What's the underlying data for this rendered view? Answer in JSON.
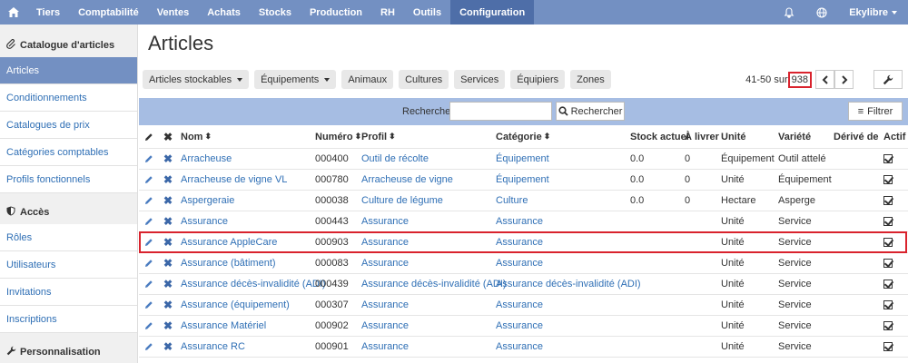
{
  "topnav": {
    "home_icon": "home-icon",
    "items": [
      "Tiers",
      "Comptabilité",
      "Ventes",
      "Achats",
      "Stocks",
      "Production",
      "RH",
      "Outils",
      "Configuration"
    ],
    "active": "Configuration",
    "user": "Ekylibre",
    "right_icons": [
      "bell-icon",
      "globe-icon"
    ]
  },
  "sidebar": {
    "sections": [
      {
        "title": "Catalogue d'articles",
        "icon": "paperclip-icon",
        "items": [
          "Articles",
          "Conditionnements",
          "Catalogues de prix",
          "Catégories comptables",
          "Profils fonctionnels"
        ]
      },
      {
        "title": "Accès",
        "icon": "shield-icon",
        "items": [
          "Rôles",
          "Utilisateurs",
          "Invitations",
          "Inscriptions"
        ]
      },
      {
        "title": "Personnalisation",
        "icon": "wrench-icon",
        "items": []
      }
    ],
    "active": "Articles"
  },
  "main": {
    "title": "Articles",
    "filters": [
      {
        "label": "Articles stockables",
        "dropdown": true
      },
      {
        "label": "Équipements",
        "dropdown": true
      },
      {
        "label": "Animaux",
        "dropdown": false
      },
      {
        "label": "Cultures",
        "dropdown": false
      },
      {
        "label": "Services",
        "dropdown": false
      },
      {
        "label": "Équipiers",
        "dropdown": false
      },
      {
        "label": "Zones",
        "dropdown": false
      }
    ],
    "pager": {
      "range": "41-50 sur",
      "total": "938"
    },
    "search": {
      "label": "Rechercher",
      "value": "",
      "button": "Rechercher",
      "filter_button": "Filtrer"
    },
    "table": {
      "headers": [
        "Nom",
        "Numéro",
        "Profil",
        "Catégorie",
        "Stock actuel",
        "À livrer",
        "Unité",
        "Variété",
        "Dérivé de",
        "Actif"
      ],
      "rows": [
        {
          "nom": "Arracheuse",
          "numero": "000400",
          "profil": "Outil de récolte",
          "categorie": "Équipement",
          "stock": "0.0",
          "livrer": "0",
          "unite": "Équipement",
          "variete": "Outil attelé",
          "derive": "",
          "actif": true
        },
        {
          "nom": "Arracheuse de vigne VL",
          "numero": "000780",
          "profil": "Arracheuse de vigne",
          "categorie": "Équipement",
          "stock": "0.0",
          "livrer": "0",
          "unite": "Unité",
          "variete": "Équipement",
          "derive": "",
          "actif": true
        },
        {
          "nom": "Aspergeraie",
          "numero": "000038",
          "profil": "Culture de légume",
          "categorie": "Culture",
          "stock": "0.0",
          "livrer": "0",
          "unite": "Hectare",
          "variete": "Asperge",
          "derive": "",
          "actif": true
        },
        {
          "nom": "Assurance",
          "numero": "000443",
          "profil": "Assurance",
          "categorie": "Assurance",
          "stock": "",
          "livrer": "",
          "unite": "Unité",
          "variete": "Service",
          "derive": "",
          "actif": true
        },
        {
          "nom": "Assurance AppleCare",
          "numero": "000903",
          "profil": "Assurance",
          "categorie": "Assurance",
          "stock": "",
          "livrer": "",
          "unite": "Unité",
          "variete": "Service",
          "derive": "",
          "actif": true
        },
        {
          "nom": "Assurance (bâtiment)",
          "numero": "000083",
          "profil": "Assurance",
          "categorie": "Assurance",
          "stock": "",
          "livrer": "",
          "unite": "Unité",
          "variete": "Service",
          "derive": "",
          "actif": true
        },
        {
          "nom": "Assurance décès-invalidité (ADI)",
          "numero": "000439",
          "profil": "Assurance décès-invalidité (ADI)",
          "categorie": "Assurance décès-invalidité (ADI)",
          "stock": "",
          "livrer": "",
          "unite": "Unité",
          "variete": "Service",
          "derive": "",
          "actif": true
        },
        {
          "nom": "Assurance (équipement)",
          "numero": "000307",
          "profil": "Assurance",
          "categorie": "Assurance",
          "stock": "",
          "livrer": "",
          "unite": "Unité",
          "variete": "Service",
          "derive": "",
          "actif": true
        },
        {
          "nom": "Assurance Matériel",
          "numero": "000902",
          "profil": "Assurance",
          "categorie": "Assurance",
          "stock": "",
          "livrer": "",
          "unite": "Unité",
          "variete": "Service",
          "derive": "",
          "actif": true
        },
        {
          "nom": "Assurance RC",
          "numero": "000901",
          "profil": "Assurance",
          "categorie": "Assurance",
          "stock": "",
          "livrer": "",
          "unite": "Unité",
          "variete": "Service",
          "derive": "",
          "actif": true
        }
      ],
      "highlighted_row": "Assurance AppleCare"
    }
  },
  "colors": {
    "nav": "#7390c2",
    "nav_active": "#4e6ea8",
    "link": "#2f6fb5",
    "highlight": "#d9232d",
    "searchbar": "#a6bde3"
  }
}
